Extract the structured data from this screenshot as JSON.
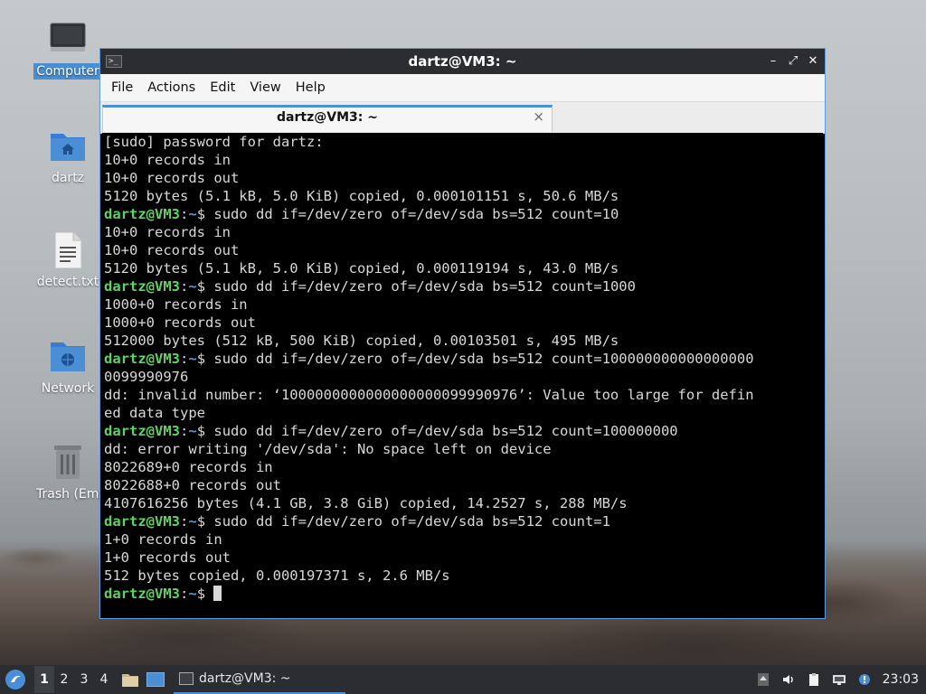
{
  "desktop": {
    "icons": [
      {
        "label": "Computer",
        "icon": "computer-icon"
      },
      {
        "label": "dartz",
        "icon": "home-folder-icon"
      },
      {
        "label": "detect.txt",
        "icon": "text-file-icon"
      },
      {
        "label": "Network",
        "icon": "network-folder-icon"
      },
      {
        "label": "Trash (Empt",
        "icon": "trash-icon"
      }
    ]
  },
  "window": {
    "title": "dartz@VM3: ~",
    "menu": [
      "File",
      "Actions",
      "Edit",
      "View",
      "Help"
    ],
    "tab_title": "dartz@VM3: ~",
    "tab_close": "×",
    "controls": {
      "minimize": "–",
      "maximize": "⤢",
      "close": "✕"
    }
  },
  "terminal": {
    "prompt_user": "dartz@VM3",
    "prompt_sep": ":",
    "prompt_path": "~",
    "prompt_dollar": "$ ",
    "lines": [
      {
        "type": "out",
        "text": "[sudo] password for dartz:"
      },
      {
        "type": "out",
        "text": "10+0 records in"
      },
      {
        "type": "out",
        "text": "10+0 records out"
      },
      {
        "type": "out",
        "text": "5120 bytes (5.1 kB, 5.0 KiB) copied, 0.000101151 s, 50.6 MB/s"
      },
      {
        "type": "cmd",
        "text": "sudo dd if=/dev/zero of=/dev/sda bs=512 count=10"
      },
      {
        "type": "out",
        "text": "10+0 records in"
      },
      {
        "type": "out",
        "text": "10+0 records out"
      },
      {
        "type": "out",
        "text": "5120 bytes (5.1 kB, 5.0 KiB) copied, 0.000119194 s, 43.0 MB/s"
      },
      {
        "type": "cmd",
        "text": "sudo dd if=/dev/zero of=/dev/sda bs=512 count=1000"
      },
      {
        "type": "out",
        "text": "1000+0 records in"
      },
      {
        "type": "out",
        "text": "1000+0 records out"
      },
      {
        "type": "out",
        "text": "512000 bytes (512 kB, 500 KiB) copied, 0.00103501 s, 495 MB/s"
      },
      {
        "type": "cmd",
        "text": "sudo dd if=/dev/zero of=/dev/sda bs=512 count=100000000000000000"
      },
      {
        "type": "out",
        "text": "0099990976"
      },
      {
        "type": "out",
        "text": "dd: invalid number: ‘1000000000000000000099990976’: Value too large for defin"
      },
      {
        "type": "out",
        "text": "ed data type"
      },
      {
        "type": "cmd",
        "text": "sudo dd if=/dev/zero of=/dev/sda bs=512 count=100000000"
      },
      {
        "type": "out",
        "text": "dd: error writing '/dev/sda': No space left on device"
      },
      {
        "type": "out",
        "text": "8022689+0 records in"
      },
      {
        "type": "out",
        "text": "8022688+0 records out"
      },
      {
        "type": "out",
        "text": "4107616256 bytes (4.1 GB, 3.8 GiB) copied, 14.2527 s, 288 MB/s"
      },
      {
        "type": "cmd",
        "text": "sudo dd if=/dev/zero of=/dev/sda bs=512 count=1"
      },
      {
        "type": "out",
        "text": "1+0 records in"
      },
      {
        "type": "out",
        "text": "1+0 records out"
      },
      {
        "type": "out",
        "text": "512 bytes copied, 0.000197371 s, 2.6 MB/s"
      },
      {
        "type": "prompt",
        "text": ""
      }
    ]
  },
  "taskbar": {
    "workspaces": [
      "1",
      "2",
      "3",
      "4"
    ],
    "active_workspace": "1",
    "app_label": "dartz@VM3: ~",
    "clock": "23:03"
  },
  "colors": {
    "prompt_user": "#5fd35f",
    "prompt_path": "#5c9be0",
    "accent": "#4a8fd6"
  }
}
